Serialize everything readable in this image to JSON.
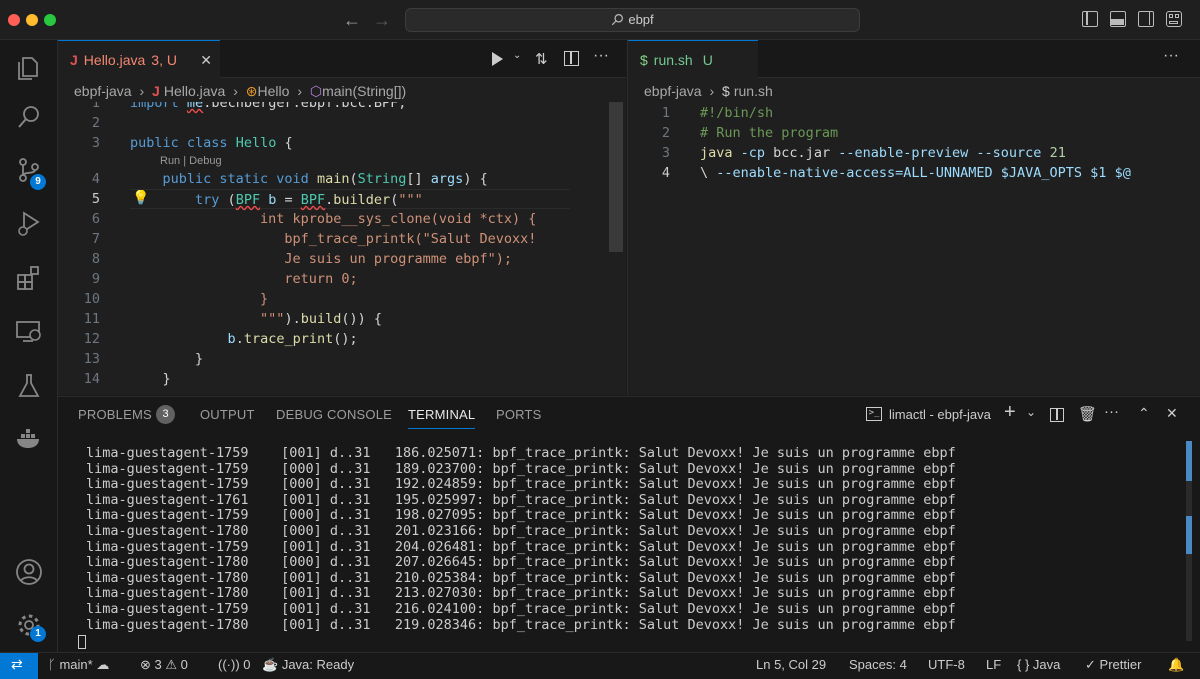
{
  "titlebar": {
    "search": "ebpf",
    "search_icon": "search-icon"
  },
  "activity": {
    "source_control_badge": "9",
    "settings_badge": "1"
  },
  "editor1": {
    "tab_label": "Hello.java",
    "tab_status": "3, U",
    "breadcrumb": [
      "ebpf-java",
      "Hello.java",
      "Hello",
      "main(String[])"
    ],
    "codelens": "Run | Debug",
    "line_numbers": [
      "1",
      "2",
      "3",
      "4",
      "5",
      "6",
      "7",
      "8",
      "9",
      "10",
      "11",
      "12",
      "13",
      "14"
    ],
    "current_line": "5"
  },
  "editor2": {
    "tab_label": "run.sh",
    "tab_status": "U",
    "breadcrumb": [
      "ebpf-java",
      "run.sh"
    ],
    "line_numbers": [
      "1",
      "2",
      "3",
      "4"
    ],
    "current_line": "4"
  },
  "panel": {
    "tabs": [
      "PROBLEMS",
      "OUTPUT",
      "DEBUG CONSOLE",
      "TERMINAL",
      "PORTS"
    ],
    "problems_count": "3",
    "active_tab": "TERMINAL",
    "terminal_name": "limactl - ebpf-java",
    "terminal_lines": [
      {
        "proc": "lima-guestagent-1759",
        "cpu": "[001]",
        "flags": "d..31",
        "ts": "186.025071:",
        "msg": "bpf_trace_printk: Salut Devoxx! Je suis un programme ebpf"
      },
      {
        "proc": "lima-guestagent-1759",
        "cpu": "[000]",
        "flags": "d..31",
        "ts": "189.023700:",
        "msg": "bpf_trace_printk: Salut Devoxx! Je suis un programme ebpf"
      },
      {
        "proc": "lima-guestagent-1759",
        "cpu": "[000]",
        "flags": "d..31",
        "ts": "192.024859:",
        "msg": "bpf_trace_printk: Salut Devoxx! Je suis un programme ebpf"
      },
      {
        "proc": "lima-guestagent-1761",
        "cpu": "[001]",
        "flags": "d..31",
        "ts": "195.025997:",
        "msg": "bpf_trace_printk: Salut Devoxx! Je suis un programme ebpf"
      },
      {
        "proc": "lima-guestagent-1759",
        "cpu": "[000]",
        "flags": "d..31",
        "ts": "198.027095:",
        "msg": "bpf_trace_printk: Salut Devoxx! Je suis un programme ebpf"
      },
      {
        "proc": "lima-guestagent-1780",
        "cpu": "[000]",
        "flags": "d..31",
        "ts": "201.023166:",
        "msg": "bpf_trace_printk: Salut Devoxx! Je suis un programme ebpf"
      },
      {
        "proc": "lima-guestagent-1759",
        "cpu": "[001]",
        "flags": "d..31",
        "ts": "204.026481:",
        "msg": "bpf_trace_printk: Salut Devoxx! Je suis un programme ebpf"
      },
      {
        "proc": "lima-guestagent-1780",
        "cpu": "[000]",
        "flags": "d..31",
        "ts": "207.026645:",
        "msg": "bpf_trace_printk: Salut Devoxx! Je suis un programme ebpf"
      },
      {
        "proc": "lima-guestagent-1780",
        "cpu": "[001]",
        "flags": "d..31",
        "ts": "210.025384:",
        "msg": "bpf_trace_printk: Salut Devoxx! Je suis un programme ebpf"
      },
      {
        "proc": "lima-guestagent-1780",
        "cpu": "[001]",
        "flags": "d..31",
        "ts": "213.027030:",
        "msg": "bpf_trace_printk: Salut Devoxx! Je suis un programme ebpf"
      },
      {
        "proc": "lima-guestagent-1759",
        "cpu": "[001]",
        "flags": "d..31",
        "ts": "216.024100:",
        "msg": "bpf_trace_printk: Salut Devoxx! Je suis un programme ebpf"
      },
      {
        "proc": "lima-guestagent-1780",
        "cpu": "[001]",
        "flags": "d..31",
        "ts": "219.028346:",
        "msg": "bpf_trace_printk: Salut Devoxx! Je suis un programme ebpf"
      }
    ]
  },
  "statusbar": {
    "branch": "main*",
    "errors": "3",
    "warnings": "0",
    "ports": "0",
    "java_status": "Java: Ready",
    "position": "Ln 5, Col 29",
    "spaces": "Spaces: 4",
    "encoding": "UTF-8",
    "eol": "LF",
    "language": "Java",
    "formatter": "Prettier"
  },
  "colors": {
    "accent": "#0078d4",
    "error": "#f14c4c",
    "java": "#e05252"
  }
}
